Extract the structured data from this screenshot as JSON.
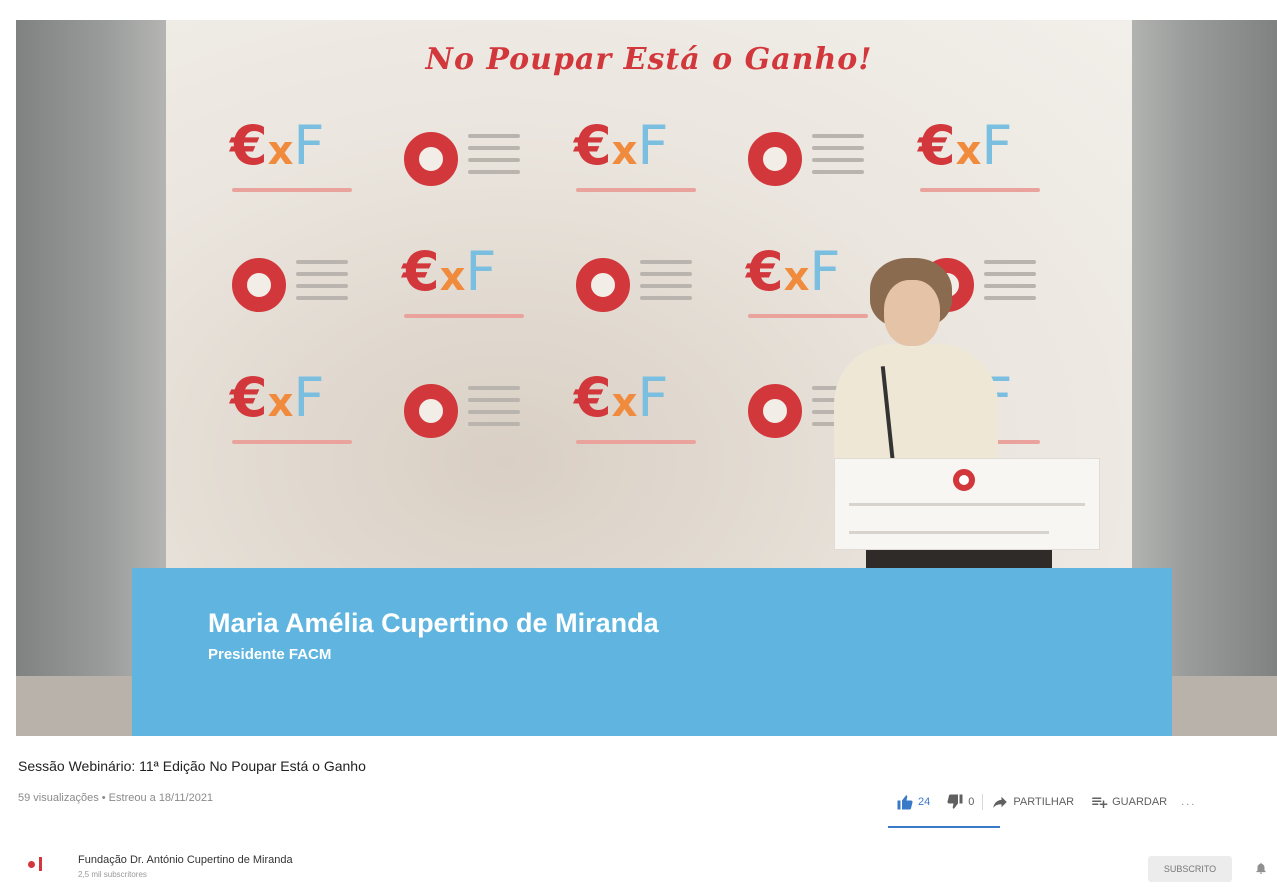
{
  "video": {
    "backdrop_title": "No Poupar Está o Ganho!",
    "brand_mark": {
      "e": "€",
      "x": "x",
      "f": "F"
    },
    "lower_third": {
      "name": "Maria Amélia Cupertino de Miranda",
      "role": "Presidente FACM"
    }
  },
  "meta": {
    "title": "Sessão Webinário: 11ª Edição No Poupar Está o Ganho",
    "stats": "59 visualizações • Estreou a 18/11/2021"
  },
  "actions": {
    "like_count": "24",
    "dislike_count": "0",
    "share_label": "PARTILHAR",
    "save_label": "GUARDAR",
    "more_label": "..."
  },
  "channel": {
    "name": "Fundação Dr. António Cupertino de Miranda",
    "subscribers": "2,5 mil subscritores",
    "subscribe_label": "SUBSCRITO"
  },
  "colors": {
    "brand_red": "#d2373b",
    "brand_blue": "#5fb5df",
    "like_blue": "#3a78c8"
  }
}
